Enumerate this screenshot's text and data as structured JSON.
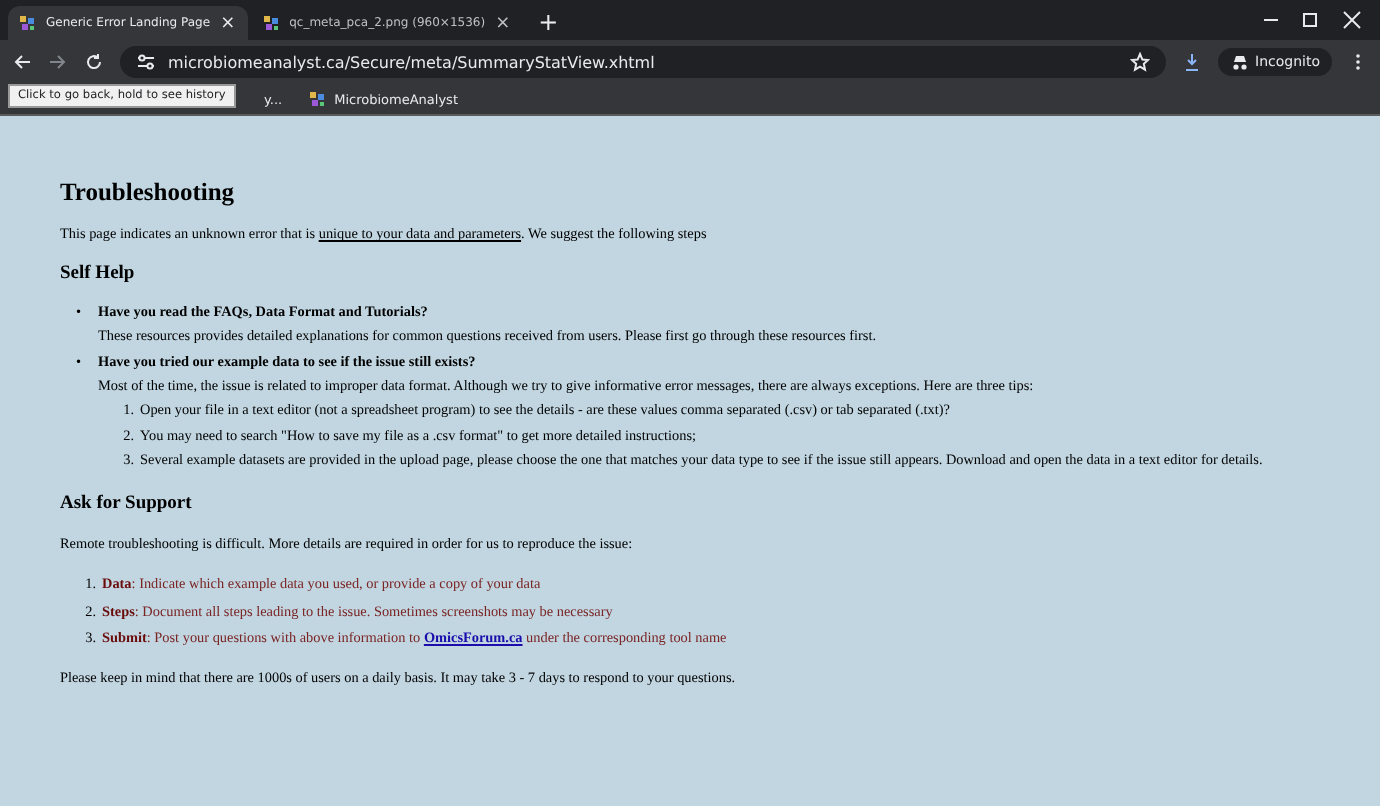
{
  "browser": {
    "tabs": [
      {
        "title": "Generic Error Landing Page",
        "selected": true,
        "close": "×"
      },
      {
        "title": "qc_meta_pca_2.png (960×1536)",
        "selected": false,
        "close": "×"
      }
    ],
    "new_tab": "+",
    "url": "microbiomeanalyst.ca/Secure/meta/SummaryStatView.xhtml",
    "profile": "Incognito",
    "bookmarks": [
      {
        "label": "y..."
      },
      {
        "label": "MicrobiomeAnalyst"
      }
    ],
    "tooltip": "Click to go back, hold to see history"
  },
  "page": {
    "title": "Troubleshooting",
    "intro": {
      "before": "This page indicates an unknown error that is ",
      "underlined": "unique to your data and parameters",
      "after": ". We suggest the following steps"
    },
    "self_help": {
      "heading": "Self Help",
      "items": [
        {
          "marker": "•",
          "question": "Have you read the FAQs, Data Format and Tutorials?",
          "text": "These resources provides detailed explanations for common questions received from users. Please first go through these resources first."
        },
        {
          "marker": "•",
          "question": "Have you tried our example data to see if the issue still exists?",
          "text": "Most of the time, the issue is related to improper data format. Although we try to give informative error messages, there are always exceptions. Here are three tips:",
          "tips": [
            {
              "number": "1.",
              "text": "Open your file in a text editor (not a spreadsheet program) to see the details - are these values comma separated (.csv) or tab separated (.txt)?"
            },
            {
              "number": "2.",
              "text": "You may need to search \"How to save my file as a .csv format\" to get more detailed instructions;"
            },
            {
              "number": "3.",
              "text": "Several example datasets are provided in the upload page, please choose the one that matches your data type to see if the issue still appears. Download and open the data in a text editor for details."
            }
          ]
        }
      ]
    },
    "support": {
      "heading": "Ask for Support",
      "intro": "Remote troubleshooting is difficult. More details are required in order for us to reproduce the issue:",
      "items": [
        {
          "number": "1.",
          "label": "Data",
          "text": ": Indicate which example data you used, or provide a copy of your data"
        },
        {
          "number": "2.",
          "label": "Steps",
          "text": ": Document all steps leading to the issue. Sometimes screenshots may be necessary"
        },
        {
          "number": "3.",
          "label": "Submit",
          "text": ": Post your questions with above information to ",
          "link": "OmicsForum.ca",
          "after": " under the corresponding tool name"
        }
      ]
    },
    "footer": "Please keep in mind that there are 1000s of users on a daily basis. It may take 3 - 7 days to respond to your questions."
  }
}
